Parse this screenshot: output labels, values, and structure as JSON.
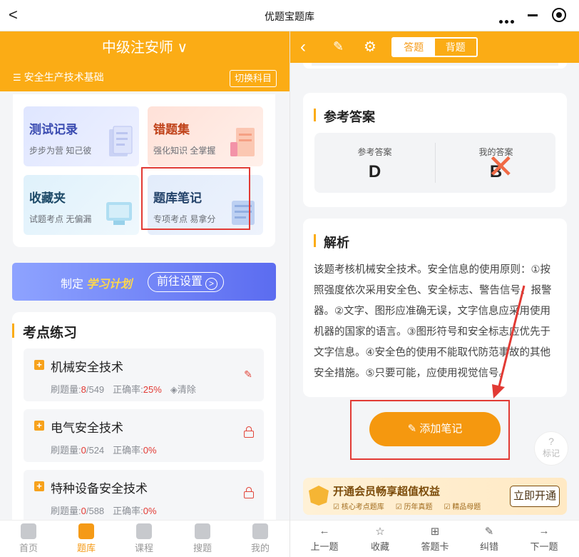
{
  "titlebar": {
    "back": "<",
    "title": "优题宝题库"
  },
  "left": {
    "exam_name": "中级注安师 ∨",
    "subject": "安全生产技术基础",
    "switch_label": "切换科目",
    "features": [
      {
        "title": "测试记录",
        "subtitle": "步步为营 知己彼"
      },
      {
        "title": "错题集",
        "subtitle": "强化知识 全掌握"
      },
      {
        "title": "收藏夹",
        "subtitle": "试题考点 无偏漏"
      },
      {
        "title": "题库笔记",
        "subtitle": "专项考点 易拿分"
      }
    ],
    "plan": {
      "prefix": "制定",
      "highlight": "学习计划",
      "button": "前往设置"
    },
    "practice": {
      "title": "考点练习",
      "items": [
        {
          "name": "机械安全技术",
          "count_label": "刷题量:",
          "done": "8",
          "total": "/549",
          "rate_label": "正确率:",
          "rate": "25%",
          "clear": "清除"
        },
        {
          "name": "电气安全技术",
          "count_label": "刷题量:",
          "done": "0",
          "total": "/524",
          "rate_label": "正确率:",
          "rate": "0%"
        },
        {
          "name": "特种设备安全技术",
          "count_label": "刷题量:",
          "done": "0",
          "total": "/588",
          "rate_label": "正确率:",
          "rate": "0%"
        }
      ]
    },
    "tabs": [
      "首页",
      "题库",
      "课程",
      "搜题",
      "我的"
    ]
  },
  "right": {
    "toggle": {
      "answer": "答题",
      "recite": "背题"
    },
    "reference": {
      "title": "参考答案",
      "ref_label": "参考答案",
      "ref_value": "D",
      "my_label": "我的答案",
      "my_value": "B"
    },
    "analysis": {
      "title": "解析",
      "text": "该题考核机械安全技术。安全信息的使用原则：①按照强度依次采用安全色、安全标志、警告信号、报警器。②文字、图形应准确无误，文字信息应采用使用机器的国家的语言。③图形符号和安全标志应优先于文字信息。④安全色的使用不能取代防范事故的其他安全措施。⑤只要可能，应使用视觉信号。"
    },
    "add_note": "添加笔记",
    "mark": {
      "q": "?",
      "label": "标记"
    },
    "vip": {
      "title": "开通会员畅享超值权益",
      "perks": [
        "核心考点题库",
        "历年真题",
        "精品母题"
      ],
      "button": "立即开通"
    },
    "tabs": [
      "上一题",
      "收藏",
      "答题卡",
      "纠错",
      "下一题"
    ]
  },
  "colors": {
    "brand": "#fbac15",
    "highlight": "#e23a34",
    "button": "#f5980f"
  }
}
